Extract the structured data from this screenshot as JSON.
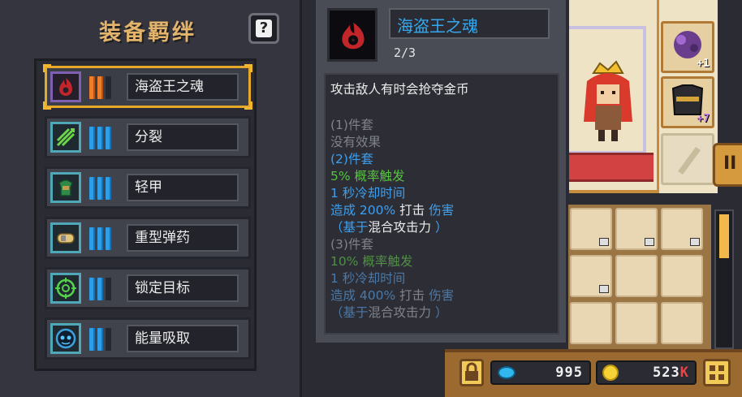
{
  "bond_panel": {
    "title": "装备羁绊",
    "help_label": "?",
    "bonds": [
      {
        "name": "海盗王之魂",
        "icon": "pirate-soul-icon",
        "tally_color": "#f07d2a",
        "selected": true
      },
      {
        "name": "分裂",
        "icon": "split-arrows-icon",
        "tally_color": "#2e9ee8",
        "selected": false
      },
      {
        "name": "轻甲",
        "icon": "light-armor-icon",
        "tally_color": "#2e9ee8",
        "selected": false
      },
      {
        "name": "重型弹药",
        "icon": "heavy-ammo-icon",
        "tally_color": "#2e9ee8",
        "selected": false
      },
      {
        "name": "锁定目标",
        "icon": "target-lock-icon",
        "tally_color": "#2e9ee8",
        "selected": false
      },
      {
        "name": "能量吸取",
        "icon": "energy-drain-icon",
        "tally_color": "#2e9ee8",
        "selected": false
      }
    ]
  },
  "tooltip": {
    "name": "海盗王之魂",
    "count": "2/3",
    "description": "攻击敌人有时会抢夺金币",
    "tier1_header": "(1)件套",
    "tier1_effect": "没有效果",
    "tier2_header": "(2)件套",
    "tier2_chance": "5% 概率触发",
    "tier2_cooldown": "1 秒冷却时间",
    "tier2_damage_pre": "造成 200% ",
    "tier2_damage_hit": "打击",
    "tier2_damage_post": " 伤害",
    "tier2_based_pre": "（基于",
    "tier2_based_hl": "混合攻击力",
    "tier2_based_post": " ）",
    "tier3_header": "(3)件套",
    "tier3_chance": "10% 概率触发",
    "tier3_cooldown": "1 秒冷却时间",
    "tier3_damage_pre": "造成 400% ",
    "tier3_damage_hit": "打击",
    "tier3_damage_post": " 伤害",
    "tier3_based_pre": "（基于",
    "tier3_based_hl": "混合攻击力",
    "tier3_based_post": " ）"
  },
  "inventory": {
    "side_tab_label": "II",
    "equip_slots": [
      {
        "icon": "purple-crystal-icon",
        "plus": "+1"
      },
      {
        "icon": "dark-chest-armor-icon",
        "plus": "+7"
      },
      {
        "icon": "empty-weapon-slot-icon",
        "plus": ""
      }
    ],
    "currency": {
      "gems": "995",
      "gold_number": "523",
      "gold_suffix": "K"
    }
  },
  "colors": {
    "accent_gold": "#e2b46c",
    "selection": "#e6a92a",
    "tooltip_name": "#35a8ef"
  }
}
